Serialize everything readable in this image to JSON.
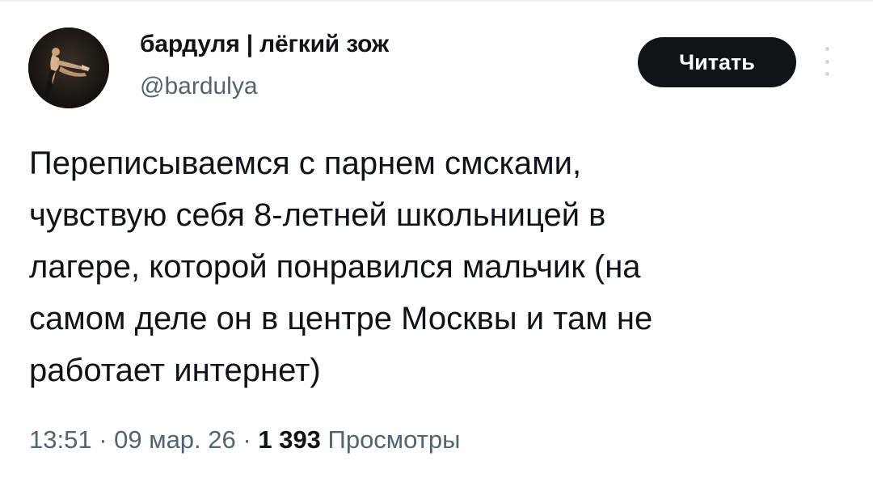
{
  "author": {
    "display_name": "бардуля | лёгкий зож",
    "handle": "@bardulya",
    "avatar_icon": "person-photo-avatar"
  },
  "follow_button": {
    "label": "Читать"
  },
  "more_icon": "vertical-dots-icon",
  "tweet": {
    "lines": [
      "Переписываемся с парнем смсками,",
      "чувствую себя 8-летней школьницей в",
      "лагере, которой понравился мальчик (на",
      "самом деле он в центре Москвы и там не",
      "работает интернет)"
    ]
  },
  "meta": {
    "time": "13:51",
    "separator": "·",
    "date": "09 мар. 26",
    "views_count": "1 393",
    "views_label": "Просмотры"
  },
  "colors": {
    "text_primary": "#0f1419",
    "text_secondary": "#536471",
    "button_bg": "#0f1419",
    "button_text": "#ffffff"
  }
}
